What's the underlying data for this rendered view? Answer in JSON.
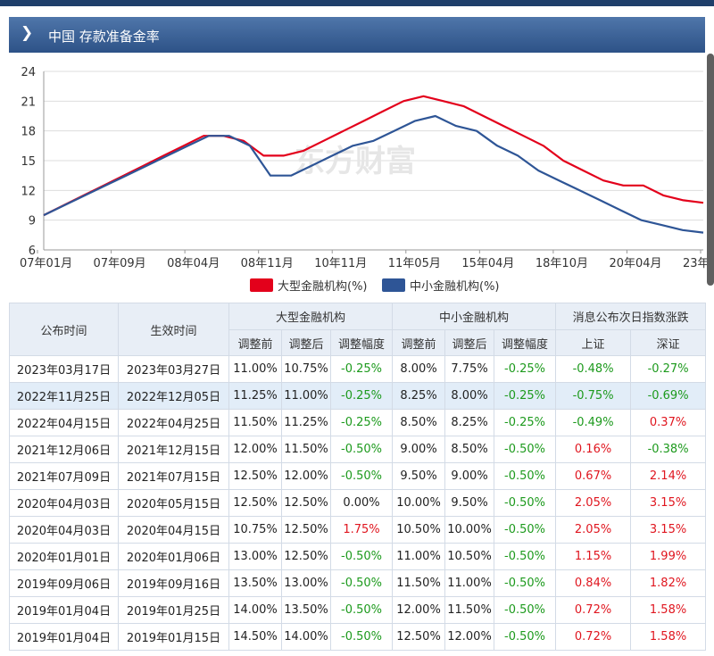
{
  "panel": {
    "title": "中国 存款准备金率",
    "chevron_icon": "chevron-right-icon"
  },
  "colors": {
    "large": "#e3001b",
    "small": "#2e5596",
    "header_bg": "#3b6198",
    "watermark": "#e6e6e6"
  },
  "chart_data": {
    "type": "line",
    "yticks": [
      6,
      9,
      12,
      15,
      18,
      21,
      24
    ],
    "ylim": [
      6,
      24
    ],
    "xtick_labels": [
      "07年01月",
      "07年09月",
      "08年04月",
      "08年11月",
      "10年11月",
      "11年05月",
      "15年04月",
      "18年10月",
      "20年04月",
      "23年"
    ],
    "watermark": "东方财富",
    "series": [
      {
        "name": "大型金融机构(%)",
        "values": [
          9.5,
          10.5,
          11.5,
          12.5,
          13.5,
          14.5,
          15.5,
          16.5,
          17.5,
          17.5,
          17.0,
          15.5,
          15.5,
          16.0,
          17.0,
          18.0,
          19.0,
          20.0,
          21.0,
          21.5,
          21.0,
          20.5,
          19.5,
          18.5,
          17.5,
          16.5,
          15.0,
          14.0,
          13.0,
          12.5,
          12.5,
          11.5,
          11.0,
          10.75
        ]
      },
      {
        "name": "中小金融机构(%)",
        "values": [
          9.5,
          10.5,
          11.5,
          12.5,
          13.5,
          14.5,
          15.5,
          16.5,
          17.5,
          17.5,
          16.5,
          13.5,
          13.5,
          14.5,
          15.5,
          16.5,
          17.0,
          18.0,
          19.0,
          19.5,
          18.5,
          18.0,
          16.5,
          15.5,
          14.0,
          13.0,
          12.0,
          11.0,
          10.0,
          9.0,
          8.5,
          8.0,
          7.75
        ]
      }
    ]
  },
  "table": {
    "headers": {
      "announce": "公布时间",
      "effective": "生效时间",
      "large": "大型金融机构",
      "small": "中小金融机构",
      "index": "消息公布次日指数涨跌",
      "before": "调整前",
      "after": "调整后",
      "range": "调整幅度",
      "sh": "上证",
      "sz": "深证"
    },
    "rows": [
      [
        "2023年03月17日",
        "2023年03月27日",
        "11.00%",
        "10.75%",
        "-0.25%",
        "8.00%",
        "7.75%",
        "-0.25%",
        "-0.48%",
        "-0.27%"
      ],
      [
        "2022年11月25日",
        "2022年12月05日",
        "11.25%",
        "11.00%",
        "-0.25%",
        "8.25%",
        "8.00%",
        "-0.25%",
        "-0.75%",
        "-0.69%"
      ],
      [
        "2022年04月15日",
        "2022年04月25日",
        "11.50%",
        "11.25%",
        "-0.25%",
        "8.50%",
        "8.25%",
        "-0.25%",
        "-0.49%",
        "0.37%"
      ],
      [
        "2021年12月06日",
        "2021年12月15日",
        "12.00%",
        "11.50%",
        "-0.50%",
        "9.00%",
        "8.50%",
        "-0.50%",
        "0.16%",
        "-0.38%"
      ],
      [
        "2021年07月09日",
        "2021年07月15日",
        "12.50%",
        "12.00%",
        "-0.50%",
        "9.50%",
        "9.00%",
        "-0.50%",
        "0.67%",
        "2.14%"
      ],
      [
        "2020年04月03日",
        "2020年05月15日",
        "12.50%",
        "12.50%",
        "0.00%",
        "10.00%",
        "9.50%",
        "-0.50%",
        "2.05%",
        "3.15%"
      ],
      [
        "2020年04月03日",
        "2020年04月15日",
        "10.75%",
        "12.50%",
        "1.75%",
        "10.50%",
        "10.00%",
        "-0.50%",
        "2.05%",
        "3.15%"
      ],
      [
        "2020年01月01日",
        "2020年01月06日",
        "13.00%",
        "12.50%",
        "-0.50%",
        "11.00%",
        "10.50%",
        "-0.50%",
        "1.15%",
        "1.99%"
      ],
      [
        "2019年09月06日",
        "2019年09月16日",
        "13.50%",
        "13.00%",
        "-0.50%",
        "11.50%",
        "11.00%",
        "-0.50%",
        "0.84%",
        "1.82%"
      ],
      [
        "2019年01月04日",
        "2019年01月25日",
        "14.00%",
        "13.50%",
        "-0.50%",
        "12.00%",
        "11.50%",
        "-0.50%",
        "0.72%",
        "1.58%"
      ],
      [
        "2019年01月04日",
        "2019年01月15日",
        "14.50%",
        "14.00%",
        "-0.50%",
        "12.50%",
        "12.00%",
        "-0.50%",
        "0.72%",
        "1.58%"
      ]
    ]
  }
}
